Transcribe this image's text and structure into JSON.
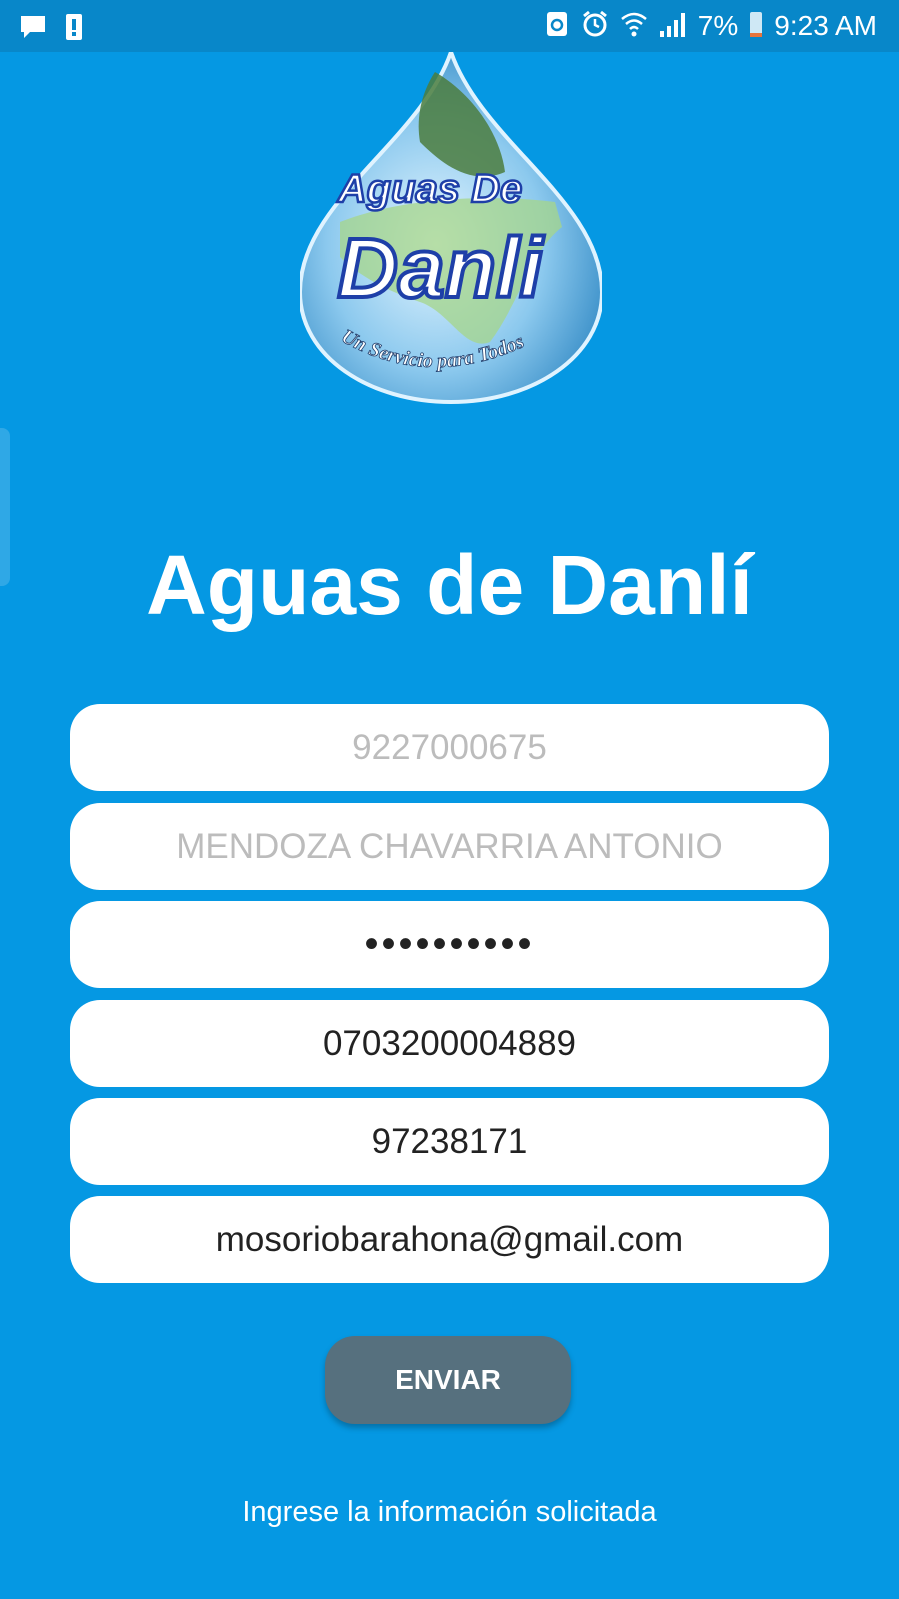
{
  "status_bar": {
    "battery_percent": "7%",
    "time": "9:23 AM",
    "icons": [
      "message-icon",
      "alert-icon",
      "recycle-icon",
      "alarm-icon",
      "wifi-icon",
      "signal-icon",
      "battery-icon"
    ]
  },
  "logo": {
    "line1": "Aguas De",
    "line2": "Danli",
    "tagline": "Un Servicio para Todos"
  },
  "title": "Aguas de Danlí",
  "form": {
    "account_placeholder": "9227000675",
    "name_placeholder": "MENDOZA CHAVARRIA ANTONIO",
    "password_value": "••••••••••",
    "id_value": "0703200004889",
    "phone_value": "97238171",
    "email_value": "mosoriobarahona@gmail.com"
  },
  "button": {
    "label": "ENVIAR"
  },
  "hint": "Ingrese la información solicitada",
  "colors": {
    "background": "#0598e3",
    "statusbar": "#0887c9",
    "button": "#56707e"
  }
}
